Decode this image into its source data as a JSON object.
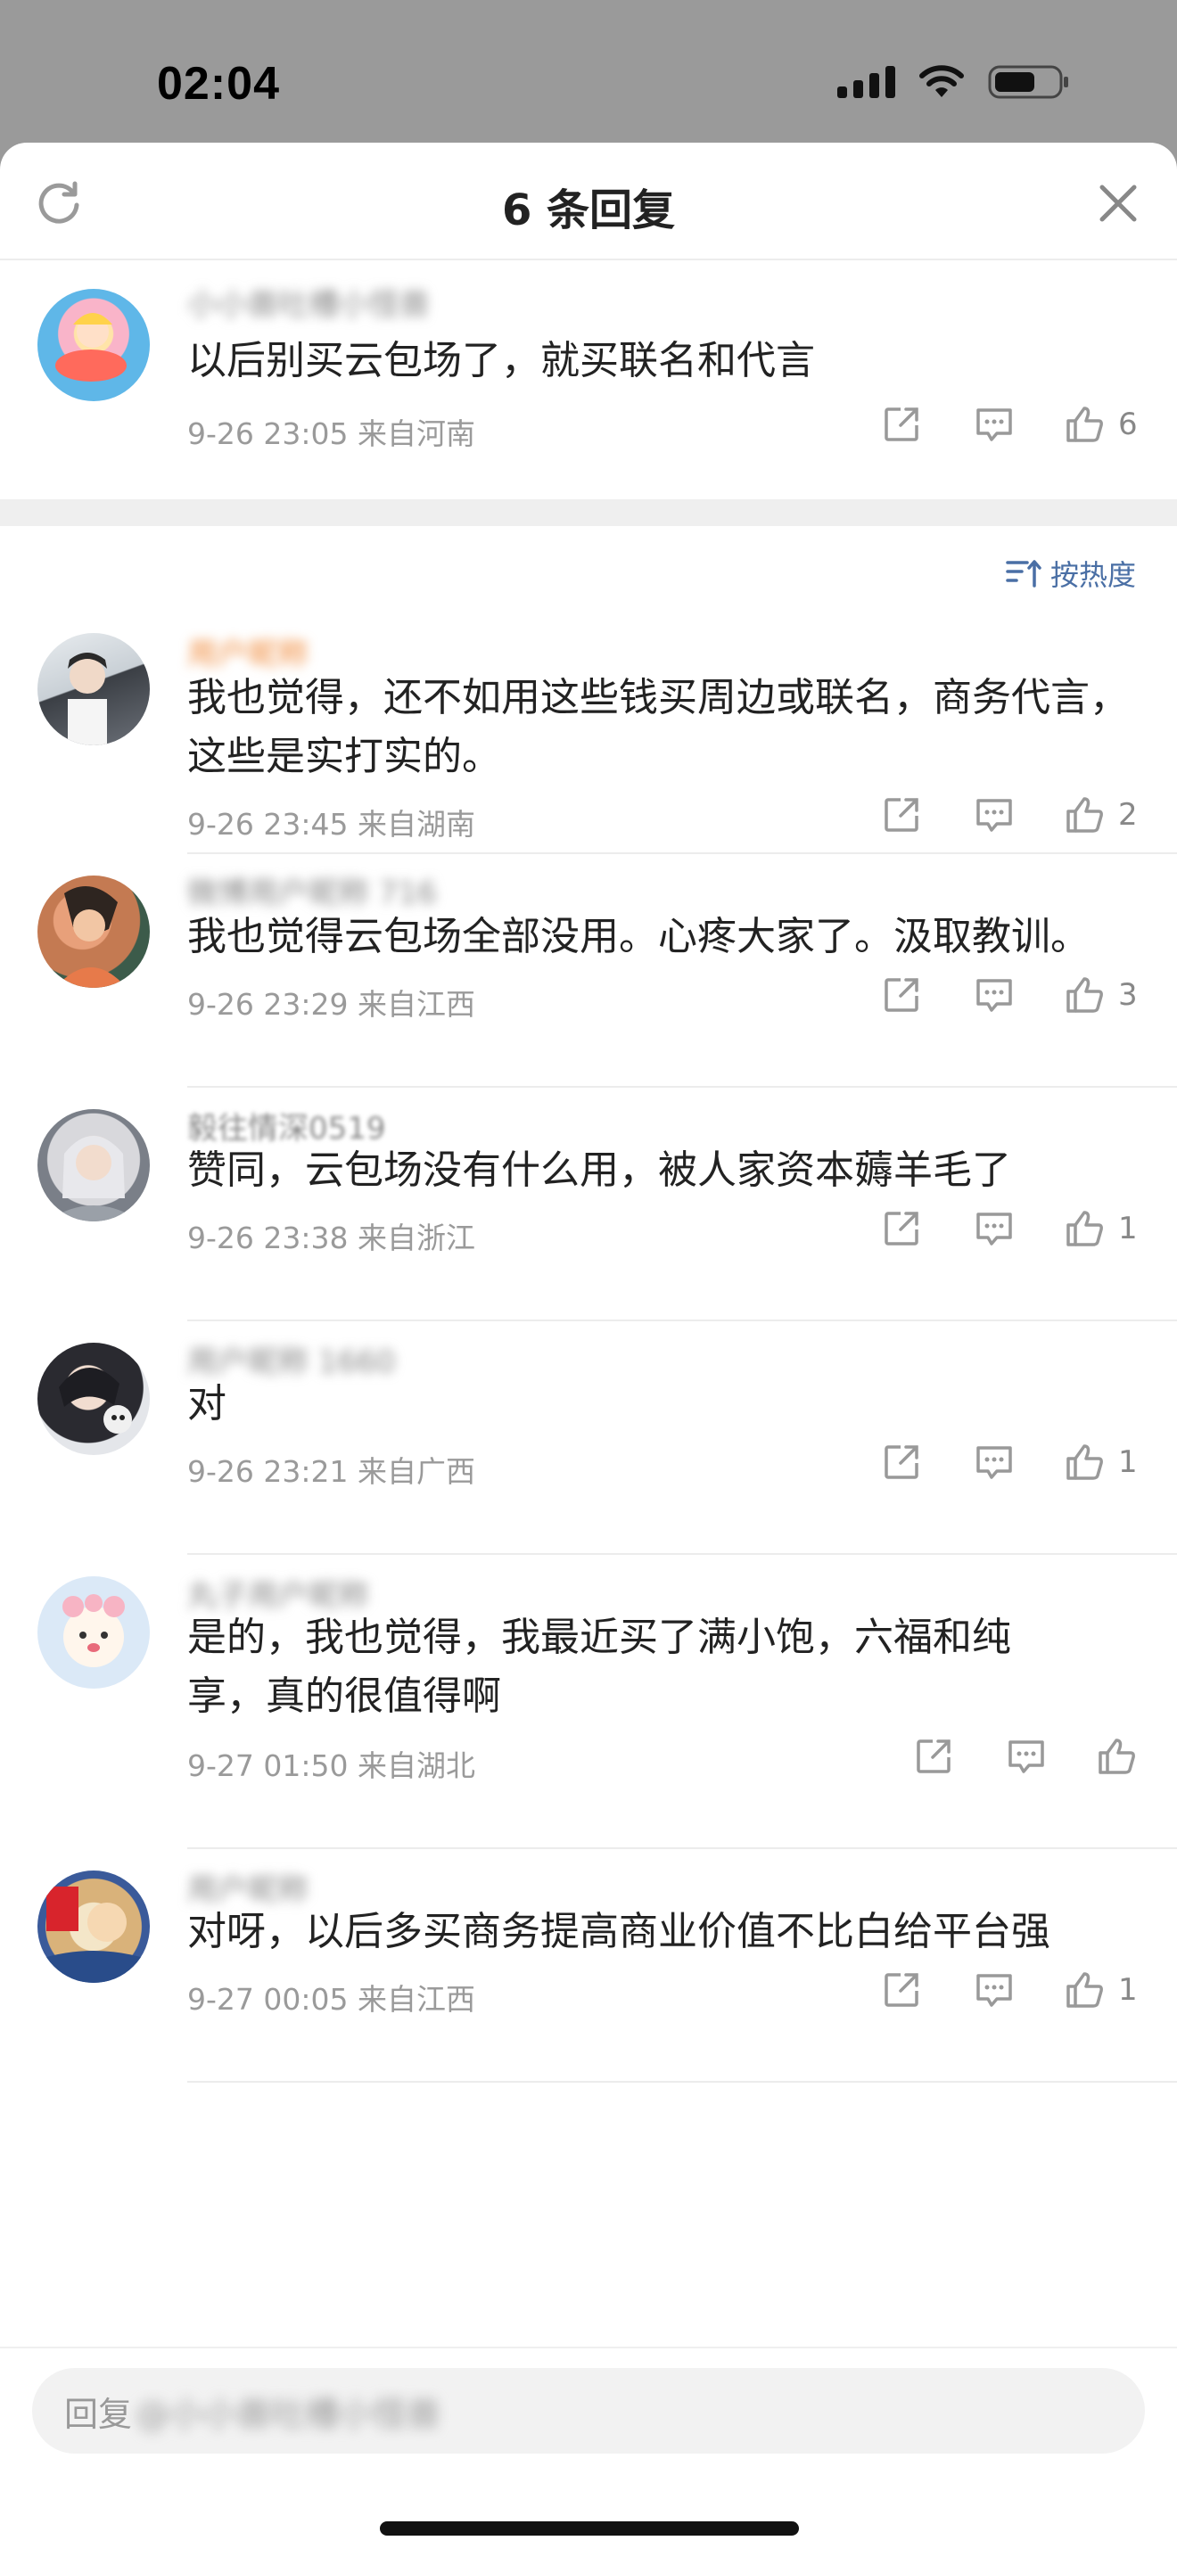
{
  "status_bar": {
    "time": "02:04"
  },
  "header": {
    "title": "6 条回复"
  },
  "top_comment": {
    "username": "小小兽吐槽小怪兽",
    "text": "以后别买云包场了，就买联名和代言",
    "meta": "9-26 23:05 来自河南",
    "like_count": "6"
  },
  "sort": {
    "label": "按热度"
  },
  "replies": [
    {
      "username": "用户昵称",
      "text": "我也觉得，还不如用这些钱买周边或联名，商务代言，这些是实打实的。",
      "meta": "9-26 23:45 来自湖南",
      "like_count": "2"
    },
    {
      "username": "微博用户昵称 716",
      "text": "我也觉得云包场全部没用。心疼大家了。汲取教训。",
      "meta": "9-26 23:29 来自江西",
      "like_count": "3"
    },
    {
      "username": "毅往情深0519",
      "text": "赞同，云包场没有什么用，被人家资本薅羊毛了",
      "meta": "9-26 23:38 来自浙江",
      "like_count": "1"
    },
    {
      "username": "用户昵称 1660",
      "text": "对",
      "meta": "9-26 23:21 来自广西",
      "like_count": "1"
    },
    {
      "username": "丸子用户昵称",
      "text": "是的，我也觉得，我最近买了满小饱，六福和纯享，真的很值得啊",
      "meta": "9-27 01:50 来自湖北",
      "like_count": ""
    },
    {
      "username": "用户昵称",
      "text": "对呀，以后多买商务提高商业价值不比白给平台强",
      "meta": "9-27 00:05 来自江西",
      "like_count": "1"
    }
  ],
  "reply_bar": {
    "prefix": "回复",
    "target": "@小小兽吐槽小怪兽"
  },
  "colors": {
    "accent": "#4a6fa5",
    "meta": "#9a9a9a",
    "text": "#222222"
  }
}
